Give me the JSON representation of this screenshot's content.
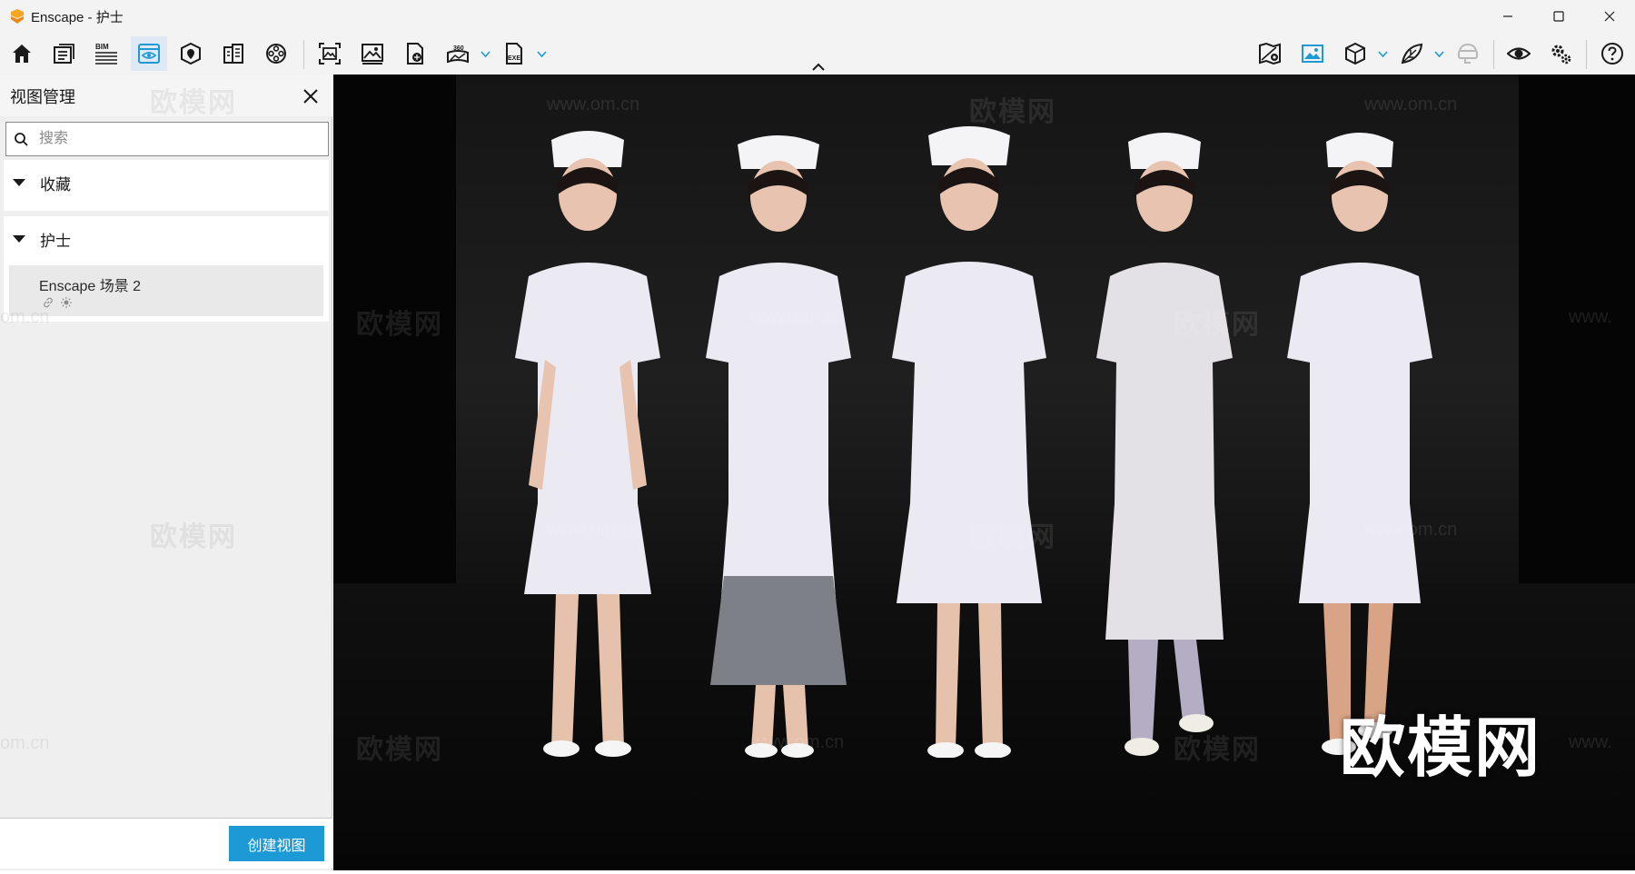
{
  "window": {
    "title": "Enscape - 护士",
    "controls": [
      "minimize-icon",
      "maximize-icon",
      "close-icon"
    ]
  },
  "toolbar": {
    "left_icons": [
      "home-icon",
      "asset-library-icon",
      "bim-icon",
      "views-eye-icon",
      "site-context-icon",
      "materials-icon",
      "video-reel-icon",
      "screenshot-icon",
      "render-image-icon",
      "web-standalone-icon",
      "panorama-360-icon",
      "exe-export-icon"
    ],
    "bim_label": "BIM",
    "pano_label": "360",
    "exe_label": "EXE",
    "active_icon": "views-eye-icon",
    "right_icons": [
      "map-location-icon",
      "image-settings-icon",
      "cube-icon",
      "leaf-icon",
      "vr-headset-icon",
      "eye-icon",
      "settings-icon",
      "help-icon"
    ]
  },
  "panel": {
    "title": "视图管理",
    "search": {
      "placeholder": "搜索",
      "value": ""
    },
    "groups": [
      {
        "label": "收藏",
        "expanded": true,
        "items": []
      },
      {
        "label": "护士",
        "expanded": true,
        "items": [
          {
            "name": "Enscape 场景 2",
            "icons": [
              "link-icon",
              "sun-icon"
            ]
          }
        ]
      }
    ],
    "create_button": "创建视图"
  },
  "viewport": {
    "watermark_text": "欧模网",
    "watermark_url": "www.om.cn",
    "watermark_url_partial": "om.cn",
    "watermark_url_edge": "www.",
    "brand_watermark": "欧模网"
  },
  "colors": {
    "accent": "#1c9ad6",
    "toolbar_bg": "#f3f3f3",
    "panel_bg": "#efefef",
    "viewport_bg": "#050505",
    "active_tool_bg": "#dfe9f5",
    "logo": "#f5a623"
  }
}
